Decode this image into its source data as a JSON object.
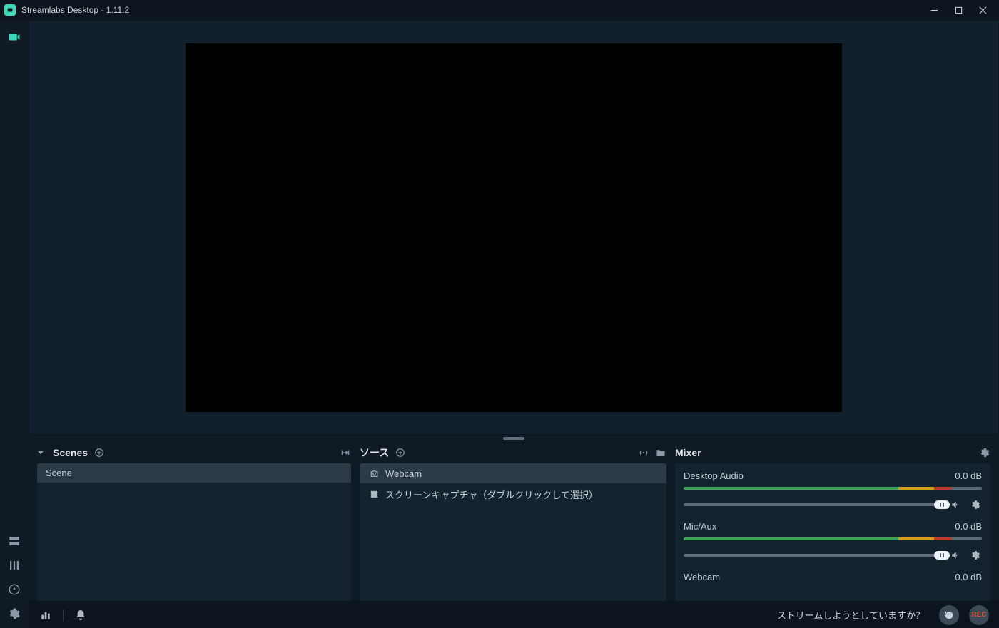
{
  "titlebar": {
    "title": "Streamlabs Desktop - 1.11.2"
  },
  "panels": {
    "scenes": {
      "title": "Scenes",
      "items": [
        "Scene"
      ]
    },
    "sources": {
      "title": "ソース",
      "items": [
        {
          "icon": "camera",
          "label": "Webcam",
          "selected": true
        },
        {
          "icon": "select-box",
          "label": "スクリーンキャプチャ（ダブルクリックして選択）",
          "selected": false
        }
      ]
    },
    "mixer": {
      "title": "Mixer",
      "items": [
        {
          "name": "Desktop Audio",
          "db": "0.0 dB"
        },
        {
          "name": "Mic/Aux",
          "db": "0.0 dB"
        },
        {
          "name": "Webcam",
          "db": "0.0 dB"
        }
      ]
    }
  },
  "footer": {
    "stream_question": "ストリームしようとしていますか？",
    "rec_label": "REC"
  }
}
